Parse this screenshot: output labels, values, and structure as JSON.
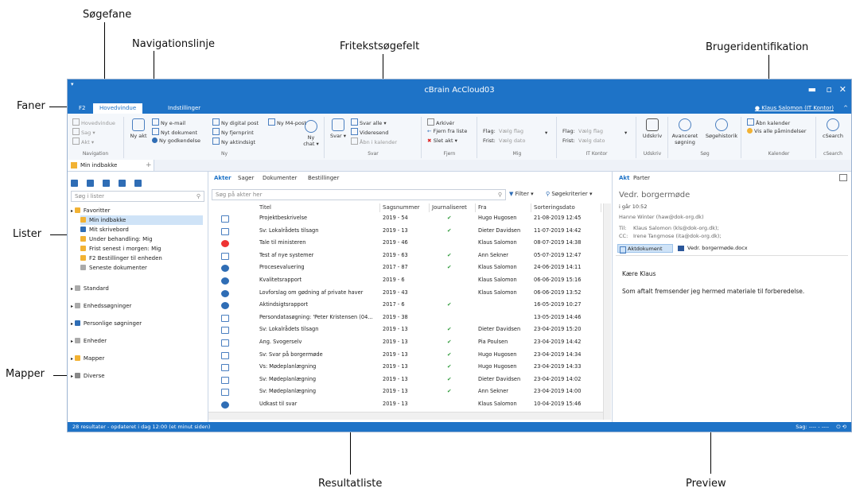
{
  "callouts": {
    "soegefane": "Søgefane",
    "navigationslinje": "Navigationslinje",
    "fritekst": "Fritekstsøgefelt",
    "brugerid": "Brugeridentifikation",
    "faner": "Faner",
    "lister": "Lister",
    "mapper": "Mapper",
    "resultatliste": "Resultatliste",
    "preview": "Preview"
  },
  "app": {
    "title": "cBrain AcCloud03",
    "tabs": [
      "F2",
      "Hovedvindue",
      "Indstillinger"
    ],
    "user": "Klaus Salomon (IT Kontor)"
  },
  "ribbon": {
    "navigation": {
      "label": "Navigation",
      "items": [
        "Hovedvindue",
        "Sag",
        "Akt"
      ]
    },
    "ny": {
      "label": "Ny",
      "big": "Ny akt",
      "items": [
        "Ny e-mail",
        "Nyt dokument",
        "Ny godkendelse",
        "Ny digital post",
        "Ny fjernprint",
        "Ny aktindsigt",
        "Ny M4-post"
      ],
      "chat": "Ny chat"
    },
    "svar": {
      "label": "Svar",
      "big": "Svar",
      "items": [
        "Svar alle",
        "Videresend",
        "Åbn i kalender"
      ]
    },
    "fjern": {
      "label": "Fjern",
      "items": [
        "Arkivér",
        "Fjern fra liste",
        "Slet akt"
      ]
    },
    "mig": {
      "label": "Mig",
      "flag": "Flag:",
      "flag_val": "Vælg flag",
      "frist": "Frist:",
      "frist_val": "Vælg dato"
    },
    "itkontor": {
      "label": "IT Kontor",
      "flag": "Flag:",
      "flag_val": "Vælg flag",
      "frist": "Frist:",
      "frist_val": "Vælg dato"
    },
    "udskriv": {
      "label": "Udskriv",
      "big": "Udskriv"
    },
    "soeg": {
      "label": "Søg",
      "adv": "Avanceret søgning",
      "hist": "Søgehistorik"
    },
    "kalender": {
      "label": "Kalender",
      "items": [
        "Åbn kalender",
        "Vis alle påmindelser"
      ]
    },
    "csearch": {
      "label": "cSearch",
      "big": "cSearch"
    }
  },
  "doctab": "Min indbakke",
  "left": {
    "search_placeholder": "Søg i lister",
    "tree": [
      {
        "label": "Favoritter",
        "level": 0,
        "color": "#f2b233"
      },
      {
        "label": "Min indbakke",
        "level": 1,
        "color": "#f2b233",
        "selected": true
      },
      {
        "label": "Mit skrivebord",
        "level": 1,
        "color": "#2f6db5"
      },
      {
        "label": "Under behandling: Mig",
        "level": 1,
        "color": "#f2b233"
      },
      {
        "label": "Frist senest i morgen: Mig",
        "level": 1,
        "color": "#f2b233"
      },
      {
        "label": "F2 Bestillinger til enheden",
        "level": 1,
        "color": "#f2b233"
      },
      {
        "label": "Seneste dokumenter",
        "level": 1,
        "color": "#aaaaaa"
      },
      {
        "label": "Standard",
        "level": 0,
        "color": "#aaaaaa"
      },
      {
        "label": "Enhedssøgninger",
        "level": 0,
        "color": "#aaaaaa"
      },
      {
        "label": "Personlige søgninger",
        "level": 0,
        "color": "#2f6db5"
      },
      {
        "label": "Enheder",
        "level": 0,
        "color": "#aaaaaa"
      },
      {
        "label": "Mapper",
        "level": 0,
        "color": "#f2b233"
      },
      {
        "label": "Diverse",
        "level": 0,
        "color": "#888888"
      }
    ]
  },
  "middle": {
    "tabs": [
      "Akter",
      "Sager",
      "Dokumenter",
      "Bestillinger"
    ],
    "search_placeholder": "Søg på akter her",
    "filter": "Filter",
    "criteria": "Søgekriterier",
    "columns": [
      "Titel",
      "Sagsnummer",
      "Journaliseret",
      "Fra",
      "Sorteringsdato"
    ],
    "rows": [
      {
        "icon": "mail",
        "title": "Projektbeskrivelse",
        "case": "2019 - 54",
        "j": "✔",
        "from": "Hugo Hugosen",
        "date": "21-08-2019 12:45"
      },
      {
        "icon": "mail",
        "title": "Sv: Lokalrådets tilsagn",
        "case": "2019 - 13",
        "j": "✔",
        "from": "Dieter Davidsen",
        "date": "11-07-2019 14:42"
      },
      {
        "icon": "red",
        "title": "Tale til ministeren",
        "case": "2019 - 46",
        "j": "",
        "from": "Klaus Salomon",
        "date": "08-07-2019 14:38"
      },
      {
        "icon": "mail",
        "title": "Test af nye systemer",
        "case": "2019 - 63",
        "j": "✔",
        "from": "Ann Sekner",
        "date": "05-07-2019 12:47"
      },
      {
        "icon": "circ",
        "title": "Procesevaluering",
        "case": "2017 - 87",
        "j": "✔",
        "from": "Klaus Salomon",
        "date": "24-06-2019 14:11"
      },
      {
        "icon": "circ",
        "title": "Kvalitetsrapport",
        "case": "2019 - 6",
        "j": "",
        "from": "Klaus Salomon",
        "date": "06-06-2019 15:16"
      },
      {
        "icon": "circ",
        "title": "Lovforslag om gødning af private haver",
        "case": "2019 - 43",
        "j": "",
        "from": "Klaus Salomon",
        "date": "06-06-2019 13:52"
      },
      {
        "icon": "circ",
        "title": "Aktindsigtsrapport",
        "case": "2017 - 6",
        "j": "✔",
        "from": "",
        "date": "16-05-2019 10:27"
      },
      {
        "icon": "doc",
        "title": "Persondatasøgning: 'Peter Kristensen (04...",
        "case": "2019 - 38",
        "j": "",
        "from": "",
        "date": "13-05-2019 14:46"
      },
      {
        "icon": "mail",
        "title": "Sv: Lokalrådets tilsagn",
        "case": "2019 - 13",
        "j": "✔",
        "from": "Dieter Davidsen",
        "date": "23-04-2019 15:20"
      },
      {
        "icon": "mail",
        "title": "Ang. Svogerselv",
        "case": "2019 - 13",
        "j": "✔",
        "from": "Pia Poulsen",
        "date": "23-04-2019 14:42"
      },
      {
        "icon": "mail",
        "title": "Sv: Svar på borgermøde",
        "case": "2019 - 13",
        "j": "✔",
        "from": "Hugo Hugosen",
        "date": "23-04-2019 14:34"
      },
      {
        "icon": "mail",
        "title": "Vs: Mødeplanlægning",
        "case": "2019 - 13",
        "j": "✔",
        "from": "Hugo Hugosen",
        "date": "23-04-2019 14:33"
      },
      {
        "icon": "mail",
        "title": "Sv: Mødeplanlægning",
        "case": "2019 - 13",
        "j": "✔",
        "from": "Dieter Davidsen",
        "date": "23-04-2019 14:02"
      },
      {
        "icon": "mail",
        "title": "Sv: Mødeplanlægning",
        "case": "2019 - 13",
        "j": "✔",
        "from": "Ann Sekner",
        "date": "23-04-2019 14:00"
      },
      {
        "icon": "circ",
        "title": "Udkast til svar",
        "case": "2019 - 13",
        "j": "",
        "from": "Klaus Salomon",
        "date": "10-04-2019 15:46"
      }
    ]
  },
  "preview": {
    "tabs": [
      "Akt",
      "Parter"
    ],
    "subject": "Vedr. borgermøde",
    "time": "i går 10:52",
    "sender": "Hanne Winter (haw@dok-org.dk)",
    "to_label": "Til:",
    "to": "Klaus Salomon (kls@dok-org.dk);",
    "cc_label": "CC:",
    "cc": "Irene Tangmose (ita@dok-org.dk);",
    "attach1": "Aktdokument",
    "attach2": "Vedr. borgermøde.docx",
    "greeting": "Kære Klaus",
    "body": "Som aftalt fremsender jeg hermed materiale til forberedelse."
  },
  "status": {
    "left": "28 resultater - opdateret i dag 12:00 (et minut siden)",
    "right": "Sag: ---- - ----"
  }
}
